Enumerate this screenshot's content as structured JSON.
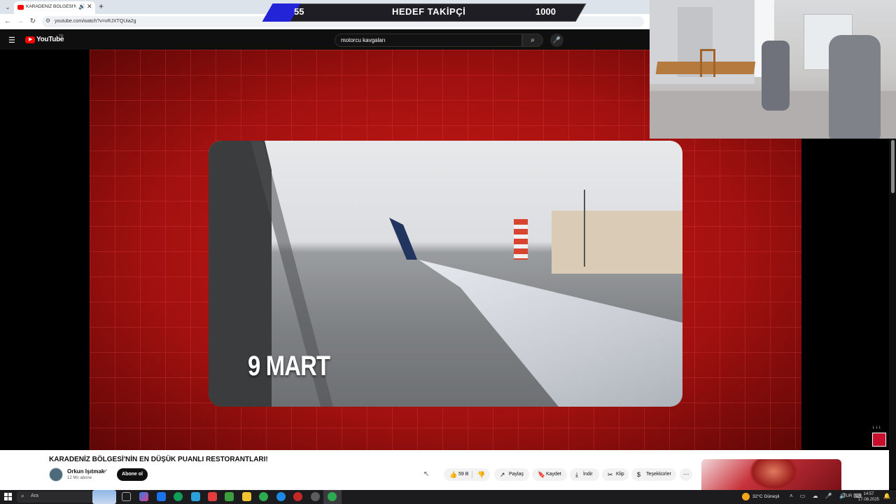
{
  "browser": {
    "tab_title": "KARADENİZ BÖLGESİ'NİN EN DÜŞÜK PUANLI RESTORANTLARI!",
    "tab_close": "✕",
    "new_tab": "+",
    "url": "youtube.com/watch?v=vRJXTQUia2g",
    "back": "←",
    "forward": "→",
    "reload": "↻"
  },
  "stream_overlay": {
    "current": "55",
    "title": "HEDEF TAKİPÇİ",
    "target": "1000",
    "progress": 0.055,
    "accent_color": "#2323d8"
  },
  "youtube": {
    "logo_text": "YouTube",
    "country": "TR",
    "search_value": "motorcu kavgaları",
    "search_icon": "search-icon",
    "mic_icon": "mic-icon"
  },
  "video": {
    "caption": "9 MART",
    "title": "KARADENİZ BÖLGESİ'NİN EN DÜŞÜK PUANLI RESTORANTLARI!",
    "channel_name": "Orkun Işıtmak",
    "subscribers": "12 Mn abone",
    "subscribe_label": "Abone ol",
    "likes": "59 B",
    "share_label": "Paylaş",
    "save_label": "Kaydet",
    "download_label": "İndir",
    "clip_label": "Klip",
    "thanks_label": "Teşekkürler",
    "more_label": "···",
    "bg_color": "#a3100f"
  },
  "taskbar": {
    "search_placeholder": "Ara",
    "weather": "32°C Güneşli",
    "language": "TUR",
    "time": "14:57",
    "date": "17.08.2025"
  }
}
